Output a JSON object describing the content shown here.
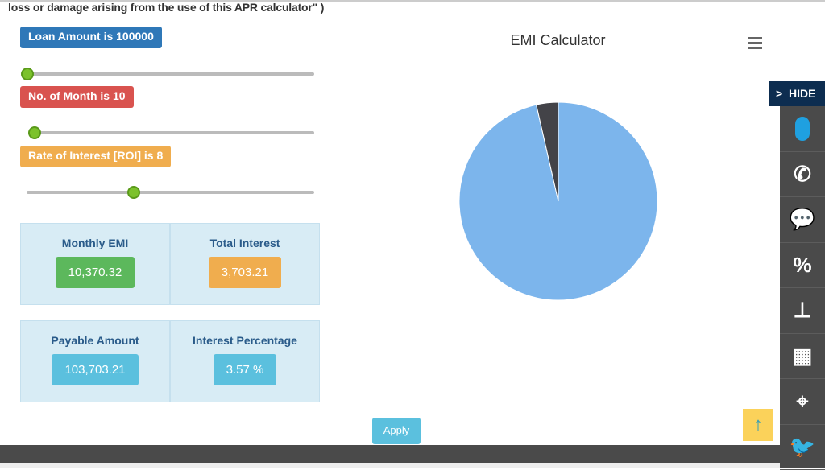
{
  "disclaimer": "loss or damage arising from the use of this APR calculator\" )",
  "sliders": [
    {
      "label": "Loan Amount is 100000",
      "color": "#2f78b8",
      "fraction": 0.0
    },
    {
      "label": "No. of Month is 10",
      "color": "#d9534f",
      "fraction": 0.02
    },
    {
      "label": "Rate of Interest [ROI] is 8",
      "color": "#f0ad4e",
      "fraction": 0.37
    }
  ],
  "results": [
    {
      "title": "Monthly EMI",
      "value": "10,370.32",
      "color": "#5cb85c"
    },
    {
      "title": "Total Interest",
      "value": "3,703.21",
      "color": "#f0ad4e"
    },
    {
      "title": "Payable Amount",
      "value": "103,703.21",
      "color": "#5bc0de"
    },
    {
      "title": "Interest Percentage",
      "value": "3.57 %",
      "color": "#5bc0de"
    }
  ],
  "apply_label": "Apply",
  "chart_data": {
    "type": "pie",
    "title": "EMI Calculator",
    "values": [
      100000,
      3703.21
    ],
    "colors": [
      "#7cb5ec",
      "#434348"
    ]
  },
  "sidebar": {
    "hide_label": "HIDE",
    "items": [
      "mouse-icon",
      "phone-icon",
      "chat-icon",
      "percent-icon",
      "sitemap-icon",
      "calculator-icon",
      "map-pin-icon",
      "twitter-icon"
    ]
  }
}
